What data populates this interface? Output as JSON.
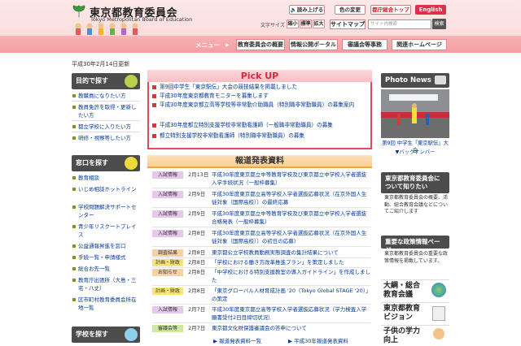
{
  "header": {
    "org_name": "東京都教育委員会",
    "org_name_en": "Tokyo Metropolitan Board of Education",
    "read_aloud": "読み上げる",
    "color_change": "色の変更",
    "city_top": "都庁総合トップ",
    "english": "English",
    "font_size_label": "文字サイズ",
    "font_small": "縮小",
    "font_standard": "標準",
    "font_large": "拡大",
    "sitemap": "サイトマップ",
    "search_placeholder": "サイト内検索",
    "search_button": "検索"
  },
  "nav": {
    "menu_label": "メニュー",
    "items": [
      "教育委員会の概要",
      "情報公開ポータル",
      "審議会等事務",
      "関連ホームページ"
    ]
  },
  "updated": "平成30年2月14日更新",
  "sidebar": {
    "purpose_title": "目的で探す",
    "purpose_items": [
      "教職員になりたい方",
      "教員免許を取得・更新したい方",
      "都立学校に入りたい方",
      "研修・視察等したい方"
    ],
    "counter_title": "窓口を探す",
    "counter_items": [
      "教育相談",
      "いじめ相談ホットライン",
      "学校問題解決サポートセンター",
      "青少年リスクートプレイス",
      "公益通報昇進を窓口",
      "手続一覧・申請様式",
      "総合お先一覧",
      "教育庁出張所（大島・三宅・八丈）",
      "区市町村教育委員会所在地一覧"
    ],
    "school_title": "学校を探す"
  },
  "pickup": {
    "title": "Pick UP",
    "items": [
      "第9回中学生「東京駅伝」大会の競技結果を掲載しました",
      "平成30年度東京都教育モニターを募集します",
      "平成30年度東京都立高等学校等非常勤介助職員（特別職非常勤職員）の募集案内",
      "平成30年度都立特別支援学校非常勤看護師（一般職非常勤職員）の募集",
      "都立特別支援学校非常勤看護師（特別職非常勤職員）の募集"
    ]
  },
  "press": {
    "title": "報道発表資料",
    "rows": [
      {
        "badge": "入試情報",
        "date": "2月13日",
        "title": "平成30年度東京都立中等教育学校及び東京都立中学校入学者選抜入学手続状況（一般枠募集）"
      },
      {
        "badge": "入試情報",
        "date": "2月9日",
        "title": "平成30年度東京都立高等学校入学者選抜応募状況（在京外国人生徒対象（国際高校））の最終応募"
      },
      {
        "badge": "入試情報",
        "date": "2月9日",
        "title": "平成30年度東京都立中等教育学校及び東京都立中学校入学者選抜合格発表（一般枠募集）"
      },
      {
        "badge": "入試情報",
        "date": "2月8日",
        "title": "平成30年度東京都立高等学校入学者選抜応募状況（在京外国人生徒対象（国際高校））の初日の応募）"
      },
      {
        "badge": "調査結果",
        "date": "2月8日",
        "title": "東京都公立学校教員勤務実態調査の集計結果について"
      },
      {
        "badge": "計画・財政",
        "date": "2月8日",
        "title": "「学校における働き方改革推進プラン」を策定しました"
      },
      {
        "badge": "お知らせ",
        "date": "2月8日",
        "title": "「中学校における特別支援教室の導入ガイドライン」を作成しました"
      },
      {
        "badge": "計画・財政",
        "date": "2月8日",
        "title": "「東京グローバル人材育成計画 '20（Tokyo Global STAGE '20）」の策定"
      },
      {
        "badge": "入試情報",
        "date": "2月7日",
        "title": "平成30年度東京都立高等学校入学者選抜応募状況（学力検査入学願書受付2日目締切状況）"
      },
      {
        "badge": "審議会等",
        "date": "2月7日",
        "title": "東京都文化財保護審議会の答申について"
      }
    ],
    "more_list": "報道発表資料一覧",
    "more_reform": "平成30年報道発表資料"
  },
  "right": {
    "photo_title": "Photo News",
    "photo_caption": "第9回 中学生「東京駅伝」大会",
    "backnumber": "▼バックナンバー",
    "about_title": "東京都教育委員会について知りたい",
    "about_text": "東京都教育委員会の概要、活動、総合教育会議などについてご紹介します",
    "policy_title": "重要な政策情報ページ",
    "policy_text": "東京都教育委員会の重要な政策情報を掲載しています。",
    "banners": [
      "大綱・総合教育会議",
      "東京都教育ビジョン",
      "子供の学力向上"
    ]
  },
  "colors": {
    "accent": "#e24a57",
    "nav_pink": "#f49ea2",
    "link": "#00379c"
  }
}
